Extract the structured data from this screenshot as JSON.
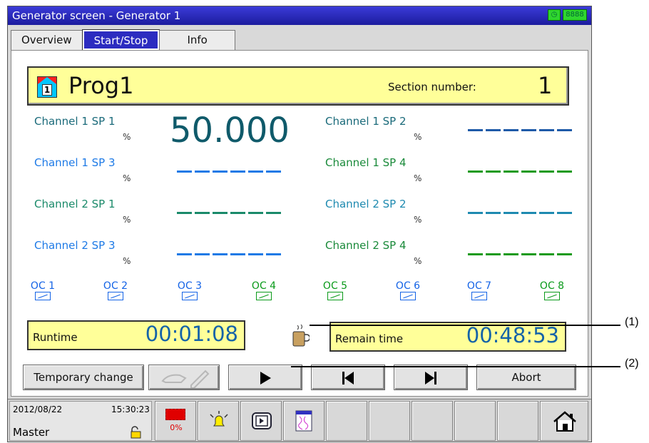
{
  "window": {
    "title": "Generator screen - Generator 1",
    "indicator_text": "8888"
  },
  "tabs": [
    "Overview",
    "Start/Stop",
    "Info"
  ],
  "program": {
    "name": "Prog1",
    "icon_number": "1",
    "section_label": "Section number:",
    "section_value": "1"
  },
  "channels": [
    {
      "name": "Channel 1 SP 1",
      "unit": "%",
      "value": "50.000",
      "color": "#0f5a6a"
    },
    {
      "name": "Channel 1 SP 2",
      "unit": "%",
      "value": "------",
      "color": "#1e5aa8"
    },
    {
      "name": "Channel 1 SP 3",
      "unit": "%",
      "value": "------",
      "color": "#1e7ae6"
    },
    {
      "name": "Channel 1 SP 4",
      "unit": "%",
      "value": "------",
      "color": "#1a9a1a"
    },
    {
      "name": "Channel 2 SP 1",
      "unit": "%",
      "value": "------",
      "color": "#1a8a6a"
    },
    {
      "name": "Channel 2 SP 2",
      "unit": "%",
      "value": "------",
      "color": "#1e8ab0"
    },
    {
      "name": "Channel 2 SP 3",
      "unit": "%",
      "value": "------",
      "color": "#1e7ae6"
    },
    {
      "name": "Channel 2 SP 4",
      "unit": "%",
      "value": "------",
      "color": "#1a9a1a"
    }
  ],
  "outputs": [
    "OC 1",
    "OC 2",
    "OC 3",
    "OC 4",
    "OC 5",
    "OC 6",
    "OC 7",
    "OC 8"
  ],
  "times": {
    "runtime_label": "Runtime",
    "runtime_value": "00:01:08",
    "remain_label": "Remain time",
    "remain_value": "00:48:53"
  },
  "buttons": {
    "temporary_change": "Temporary change",
    "abort": "Abort"
  },
  "status": {
    "date": "2012/08/22",
    "time": "15:30:23",
    "user": "Master",
    "memory": "0%"
  },
  "callouts": [
    "(1)",
    "(2)"
  ]
}
